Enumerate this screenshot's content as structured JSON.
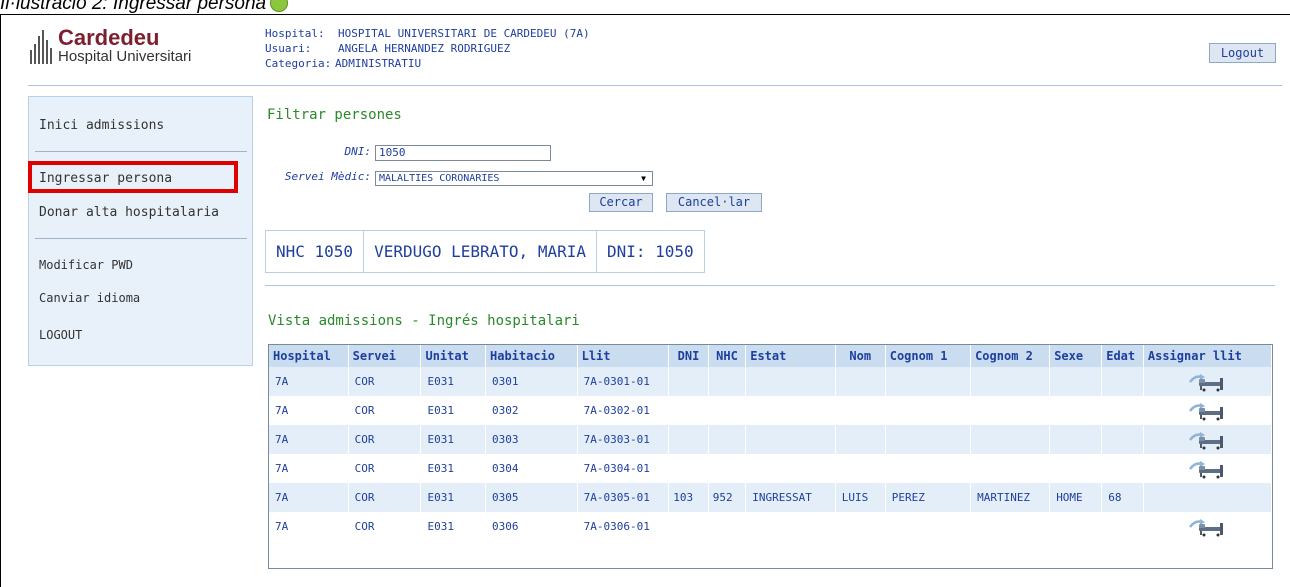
{
  "caption": "Il·lustració 2: Ingressar persona",
  "header": {
    "logo_name": "Cardedeu",
    "logo_sub": "Hospital Universitari",
    "hospital_label": "Hospital:",
    "hospital_value": "HOSPITAL UNIVERSITARI DE CARDEDEU (7A)",
    "usuari_label": "Usuari:",
    "usuari_value": "ANGELA HERNANDEZ RODRIGUEZ",
    "categoria_label": "Categoria:",
    "categoria_value": "ADMINISTRATIU",
    "logout_button": "Logout"
  },
  "sidebar": {
    "items": [
      "Inici admissions",
      "Ingressar persona",
      "Donar alta hospitalaria",
      "Modificar PWD",
      "Canviar idioma",
      "LOGOUT"
    ]
  },
  "filter": {
    "title": "Filtrar persones",
    "dni_label": "DNI:",
    "dni_value": "1050",
    "servei_label": "Servei Mèdic:",
    "servei_value": "MALALTIES CORONARIES",
    "search_button": "Cercar",
    "cancel_button": "Cancel·lar"
  },
  "patient": {
    "nhc": "NHC 1050",
    "name": "VERDUGO LEBRATO, MARIA",
    "dni": "DNI: 1050"
  },
  "table": {
    "title": "Vista admissions - Ingrés hospitalari",
    "columns": [
      "Hospital",
      "Servei",
      "Unitat",
      "Habitacio",
      "Llit",
      "DNI",
      "NHC",
      "Estat",
      "Nom",
      "Cognom 1",
      "Cognom 2",
      "Sexe",
      "Edat",
      "Assignar llit"
    ],
    "rows": [
      {
        "hospital": "7A",
        "servei": "COR",
        "unitat": "E031",
        "habitacio": "0301",
        "llit": "7A-0301-01",
        "dni": "",
        "nhc": "",
        "estat": "",
        "nom": "",
        "cognom1": "",
        "cognom2": "",
        "sexe": "",
        "edat": "",
        "assign": true
      },
      {
        "hospital": "7A",
        "servei": "COR",
        "unitat": "E031",
        "habitacio": "0302",
        "llit": "7A-0302-01",
        "dni": "",
        "nhc": "",
        "estat": "",
        "nom": "",
        "cognom1": "",
        "cognom2": "",
        "sexe": "",
        "edat": "",
        "assign": true
      },
      {
        "hospital": "7A",
        "servei": "COR",
        "unitat": "E031",
        "habitacio": "0303",
        "llit": "7A-0303-01",
        "dni": "",
        "nhc": "",
        "estat": "",
        "nom": "",
        "cognom1": "",
        "cognom2": "",
        "sexe": "",
        "edat": "",
        "assign": true
      },
      {
        "hospital": "7A",
        "servei": "COR",
        "unitat": "E031",
        "habitacio": "0304",
        "llit": "7A-0304-01",
        "dni": "",
        "nhc": "",
        "estat": "",
        "nom": "",
        "cognom1": "",
        "cognom2": "",
        "sexe": "",
        "edat": "",
        "assign": true
      },
      {
        "hospital": "7A",
        "servei": "COR",
        "unitat": "E031",
        "habitacio": "0305",
        "llit": "7A-0305-01",
        "dni": "103",
        "nhc": "952",
        "estat": "INGRESSAT",
        "nom": "LUIS",
        "cognom1": "PEREZ",
        "cognom2": "MARTINEZ",
        "sexe": "HOME",
        "edat": "68",
        "assign": false
      },
      {
        "hospital": "7A",
        "servei": "COR",
        "unitat": "E031",
        "habitacio": "0306",
        "llit": "7A-0306-01",
        "dni": "",
        "nhc": "",
        "estat": "",
        "nom": "",
        "cognom1": "",
        "cognom2": "",
        "sexe": "",
        "edat": "",
        "assign": true
      }
    ]
  },
  "colors": {
    "link_blue": "#1f3f9e",
    "section_green": "#2a8a2a",
    "highlight_red": "#e00000",
    "brand": "#7d1f2f"
  },
  "icons": {
    "assign": "assign-bed-icon"
  }
}
